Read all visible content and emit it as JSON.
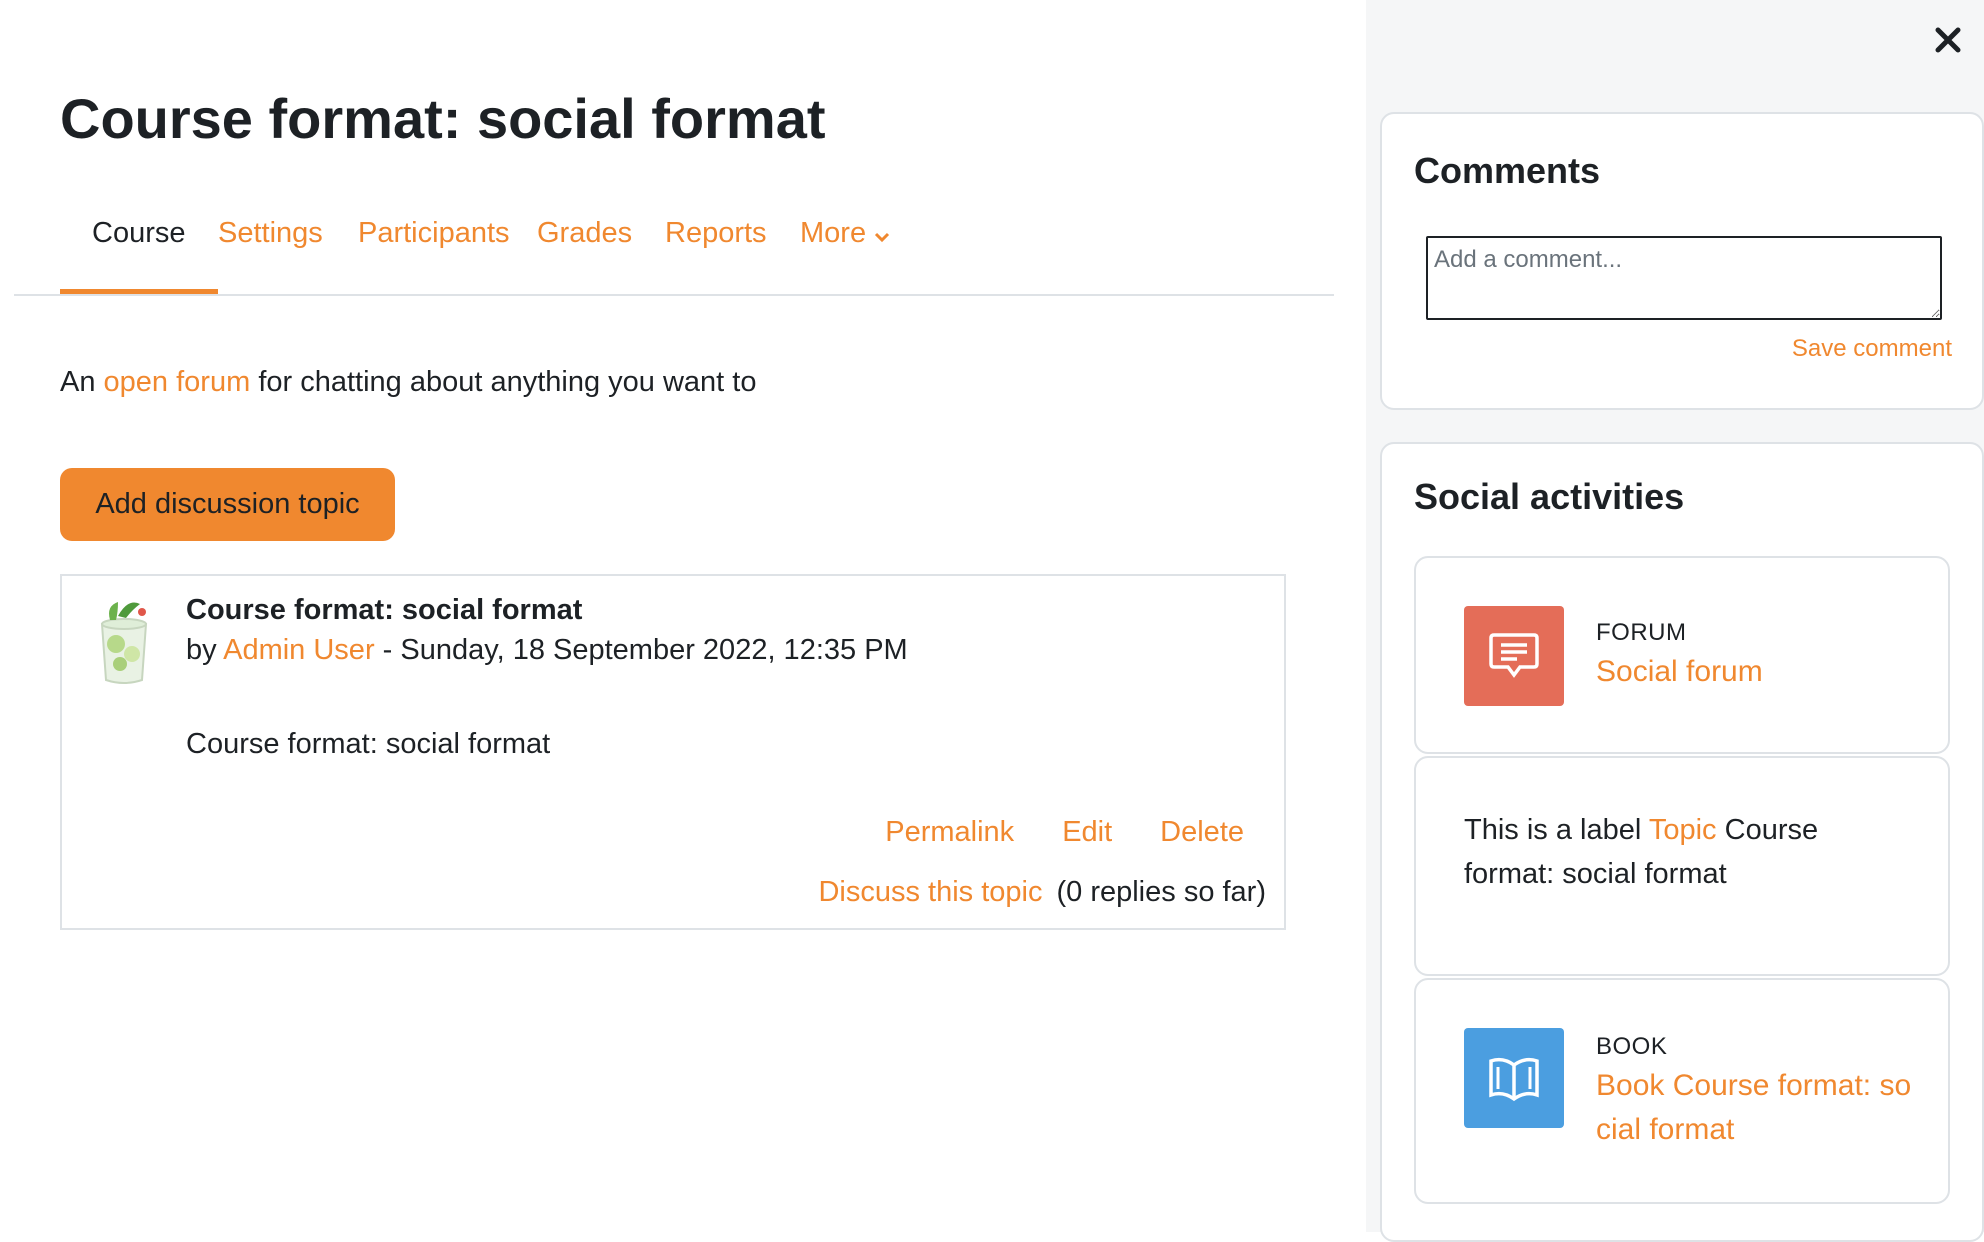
{
  "page": {
    "title": "Course format: social format"
  },
  "nav": {
    "tabs": [
      {
        "label": "Course",
        "active": true
      },
      {
        "label": "Settings",
        "active": false
      },
      {
        "label": "Participants",
        "active": false
      },
      {
        "label": "Grades",
        "active": false
      },
      {
        "label": "Reports",
        "active": false
      },
      {
        "label": "More",
        "active": false,
        "icon": "chevron-down-icon"
      }
    ]
  },
  "intro": {
    "prefix": "An",
    "link": "open forum",
    "suffix": "for chatting about anything you want to"
  },
  "add_topic_button": "Add discussion topic",
  "post": {
    "subject": "Course format: social format",
    "by": "by",
    "author": "Admin User",
    "date": "- Sunday, 18 September 2022, 12:35 PM",
    "body": "Course format: social format",
    "commands": {
      "permalink": "Permalink",
      "edit": "Edit",
      "delete": "Delete"
    },
    "discuss": "Discuss this topic",
    "replies": "(0 replies so far)"
  },
  "drawer": {
    "close_icon": "close-icon",
    "comments": {
      "title": "Comments",
      "placeholder": "Add a comment...",
      "save": "Save comment"
    },
    "social": {
      "title": "Social activities",
      "forum": {
        "type": "FORUM",
        "name": "Social forum",
        "icon": "forum-icon",
        "color": "#e46d58"
      },
      "label": {
        "prefix": "This is a label",
        "link": "Topic",
        "suffix": "Course format: social format"
      },
      "book": {
        "type": "BOOK",
        "name": "Book Course format: social format",
        "icon": "book-icon",
        "color": "#4b9ee0"
      }
    }
  },
  "colors": {
    "accent": "#f0882f",
    "text": "#1d2125",
    "border": "#dee2e6"
  }
}
